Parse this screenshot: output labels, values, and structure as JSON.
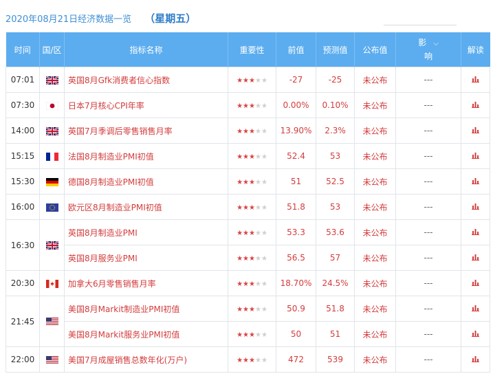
{
  "header": {
    "date_title": "2020年08月21日经济数据一览",
    "weekday": "（星期五）"
  },
  "columns": {
    "time": "时间",
    "region": "国/区",
    "indicator": "指标名称",
    "importance": "重要性",
    "previous": "前值",
    "forecast": "预测值",
    "published": "公布值",
    "influence_top": "影",
    "influence_bottom": "响",
    "interpret": "解读"
  },
  "colors": {
    "header_bg": "#5badef",
    "accent_text": "#d33c3c",
    "title_blue": "#3d8fd5"
  },
  "rows": [
    {
      "time": "07:01",
      "flag": "uk",
      "name": "英国8月Gfk消费者信心指数",
      "stars": 3,
      "previous": "-27",
      "forecast": "-25",
      "published": "未公布",
      "influence": "---"
    },
    {
      "time": "07:30",
      "flag": "jp",
      "name": "日本7月核心CPI年率",
      "stars": 3,
      "previous": "0.00%",
      "forecast": "0.10%",
      "published": "未公布",
      "influence": "---"
    },
    {
      "time": "14:00",
      "flag": "uk",
      "name": "英国7月季调后零售销售月率",
      "stars": 3,
      "previous": "13.90%",
      "forecast": "2.3%",
      "published": "未公布",
      "influence": "---"
    },
    {
      "time": "15:15",
      "flag": "fr",
      "name": "法国8月制造业PMI初值",
      "stars": 3,
      "previous": "52.4",
      "forecast": "53",
      "published": "未公布",
      "influence": "---"
    },
    {
      "time": "15:30",
      "flag": "de",
      "name": "德国8月制造业PMI初值",
      "stars": 3,
      "previous": "51",
      "forecast": "52.5",
      "published": "未公布",
      "influence": "---"
    },
    {
      "time": "16:00",
      "flag": "eu",
      "name": "欧元区8月制造业PMI初值",
      "stars": 3,
      "previous": "51.8",
      "forecast": "53",
      "published": "未公布",
      "influence": "---"
    },
    {
      "time": "16:30",
      "flag": "uk",
      "span": 2,
      "name": "英国8月制造业PMI",
      "stars": 3,
      "previous": "53.3",
      "forecast": "53.6",
      "published": "未公布",
      "influence": "---"
    },
    {
      "name": "英国8月服务业PMI",
      "stars": 3,
      "previous": "56.5",
      "forecast": "57",
      "published": "未公布",
      "influence": "---"
    },
    {
      "time": "20:30",
      "flag": "ca",
      "name": "加拿大6月零售销售月率",
      "stars": 3,
      "previous": "18.70%",
      "forecast": "24.5%",
      "published": "未公布",
      "influence": "---"
    },
    {
      "time": "21:45",
      "flag": "us",
      "span": 2,
      "name": "美国8月Markit制造业PMI初值",
      "stars": 3,
      "previous": "50.9",
      "forecast": "51.8",
      "published": "未公布",
      "influence": "---"
    },
    {
      "name": "美国8月Markit服务业PMI初值",
      "stars": 3,
      "previous": "50",
      "forecast": "51",
      "published": "未公布",
      "influence": "---"
    },
    {
      "time": "22:00",
      "flag": "us",
      "name": "美国7月成屋销售总数年化(万户)",
      "stars": 3,
      "previous": "472",
      "forecast": "539",
      "published": "未公布",
      "influence": "---"
    }
  ]
}
